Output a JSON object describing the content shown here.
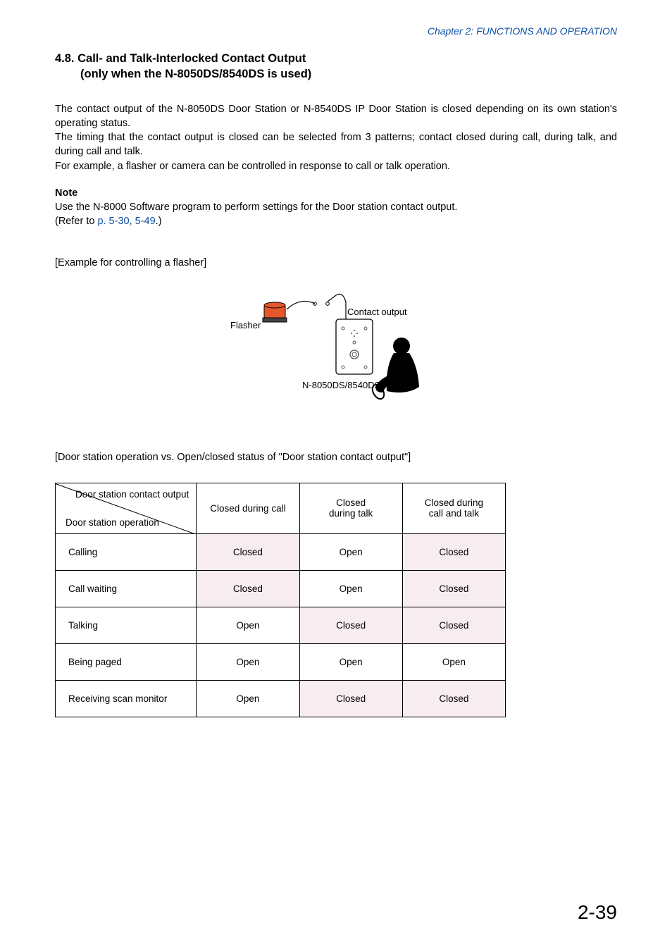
{
  "chapter_header": "Chapter 2:  FUNCTIONS AND OPERATION",
  "section": {
    "num": "4.8.",
    "title_l1": "Call- and Talk-Interlocked Contact Output",
    "title_l2": "(only when the N-8050DS/8540DS is used)"
  },
  "paragraphs": {
    "p1": "The contact output of the N-8050DS Door Station or N-8540DS IP Door Station is closed depending on its own station's operating status.",
    "p2": "The timing that the contact output is closed can be selected from 3 patterns; contact closed during call, during talk, and during call and talk.",
    "p3": "For example, a flasher or camera can be controlled in response to call or talk operation."
  },
  "note": {
    "label": "Note",
    "line1": "Use the N-8000 Software program to perform settings for the Door station contact output.",
    "line2_prefix": "(Refer to ",
    "line2_link": "p. 5-30, 5-49",
    "line2_suffix": ".)"
  },
  "example_label": "[Example for controlling a flasher]",
  "diagram": {
    "flasher": "Flasher",
    "contact": "Contact output",
    "device": "N-8050DS/8540DS"
  },
  "table_caption": "[Door station operation vs. Open/closed status of \"Door station contact output\"]",
  "table": {
    "diag_top": "Door station contact output",
    "diag_bot": "Door station operation",
    "cols": [
      "Closed during call",
      "Closed\nduring talk",
      "Closed during\ncall and talk"
    ],
    "rows": [
      {
        "label": "Calling",
        "cells": [
          {
            "v": "Closed",
            "c": true
          },
          {
            "v": "Open",
            "c": false
          },
          {
            "v": "Closed",
            "c": true
          }
        ]
      },
      {
        "label": "Call waiting",
        "cells": [
          {
            "v": "Closed",
            "c": true
          },
          {
            "v": "Open",
            "c": false
          },
          {
            "v": "Closed",
            "c": true
          }
        ]
      },
      {
        "label": "Talking",
        "cells": [
          {
            "v": "Open",
            "c": false
          },
          {
            "v": "Closed",
            "c": true
          },
          {
            "v": "Closed",
            "c": true
          }
        ]
      },
      {
        "label": "Being paged",
        "cells": [
          {
            "v": "Open",
            "c": false
          },
          {
            "v": "Open",
            "c": false
          },
          {
            "v": "Open",
            "c": false
          }
        ]
      },
      {
        "label": "Receiving scan monitor",
        "cells": [
          {
            "v": "Open",
            "c": false
          },
          {
            "v": "Closed",
            "c": true
          },
          {
            "v": "Closed",
            "c": true
          }
        ]
      }
    ]
  },
  "page_number": "2-39"
}
